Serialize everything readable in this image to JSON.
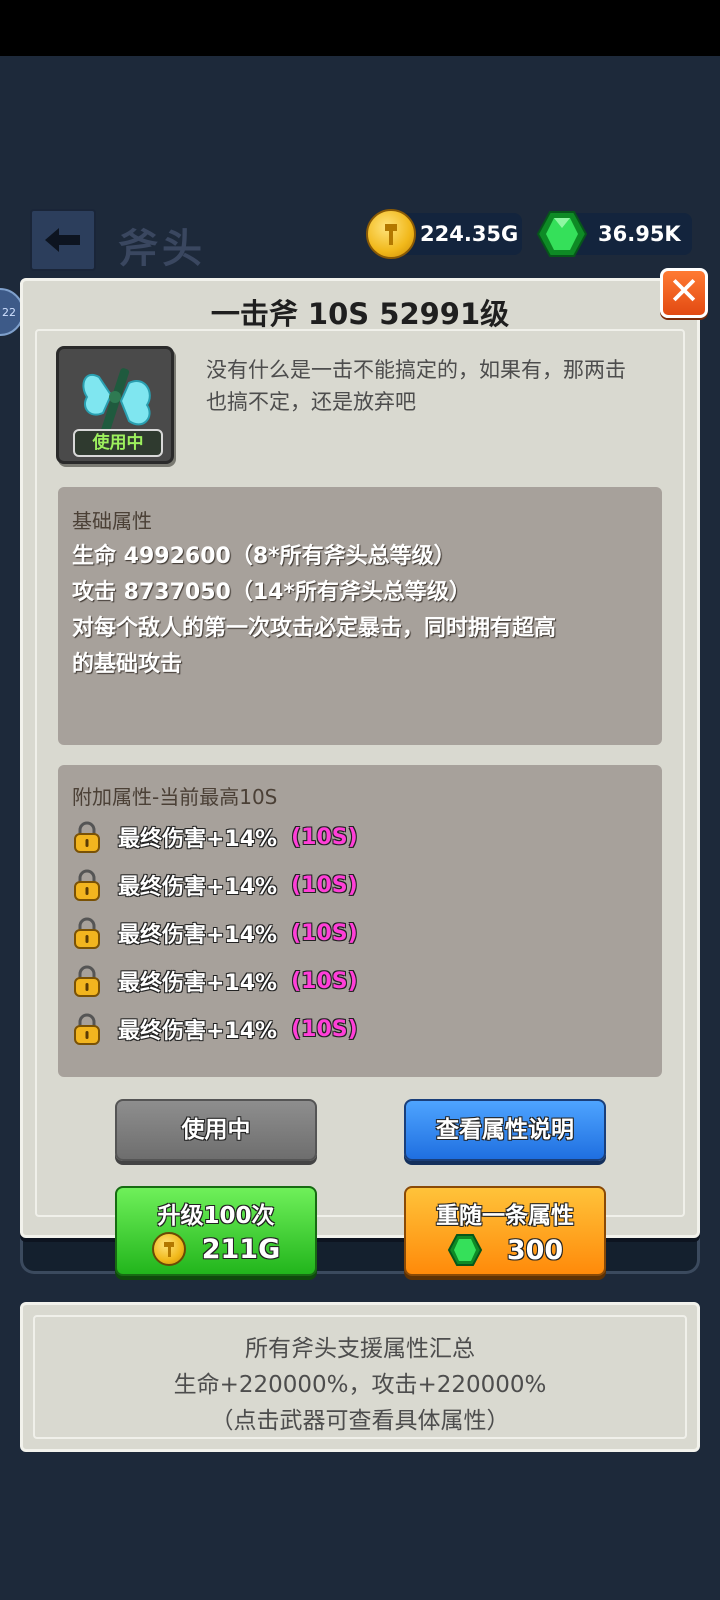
{
  "header": {
    "title": "斧头",
    "gold": "224.35G",
    "gems": "36.95K",
    "side_badge": "22"
  },
  "dialog": {
    "title": "一击斧    10S  52991级",
    "in_use_tag": "使用中",
    "description": "没有什么是一击不能搞定的，如果有，那两击也搞不定，还是放弃吧",
    "base": {
      "title": "基础属性",
      "lines": [
        "生命 4992600（8*所有斧头总等级）",
        "攻击 8737050（14*所有斧头总等级）",
        "对每个敌人的第一次攻击必定暴击，同时拥有超高",
        "的基础攻击"
      ]
    },
    "extra": {
      "title": "附加属性-当前最高10S",
      "attrs": [
        {
          "text": "最终伤害+14%",
          "tier": "(10S)"
        },
        {
          "text": "最终伤害+14%",
          "tier": "(10S)"
        },
        {
          "text": "最终伤害+14%",
          "tier": "(10S)"
        },
        {
          "text": "最终伤害+14%",
          "tier": "(10S)"
        },
        {
          "text": "最终伤害+14%",
          "tier": "(10S)"
        }
      ]
    },
    "buttons": {
      "in_use": "使用中",
      "view_attrs": "查看属性说明",
      "upgrade_label": "升级100次",
      "upgrade_cost": "211G",
      "reroll_label": "重随一条属性",
      "reroll_cost": "300"
    }
  },
  "summary": {
    "title": "所有斧头支援属性汇总",
    "stats": "生命+220000%，攻击+220000%",
    "hint": "（点击武器可查看具体属性）"
  },
  "colors": {
    "accent_pink": "#ff3fd8",
    "gold": "#f1b81a",
    "gem": "#29d64a"
  }
}
